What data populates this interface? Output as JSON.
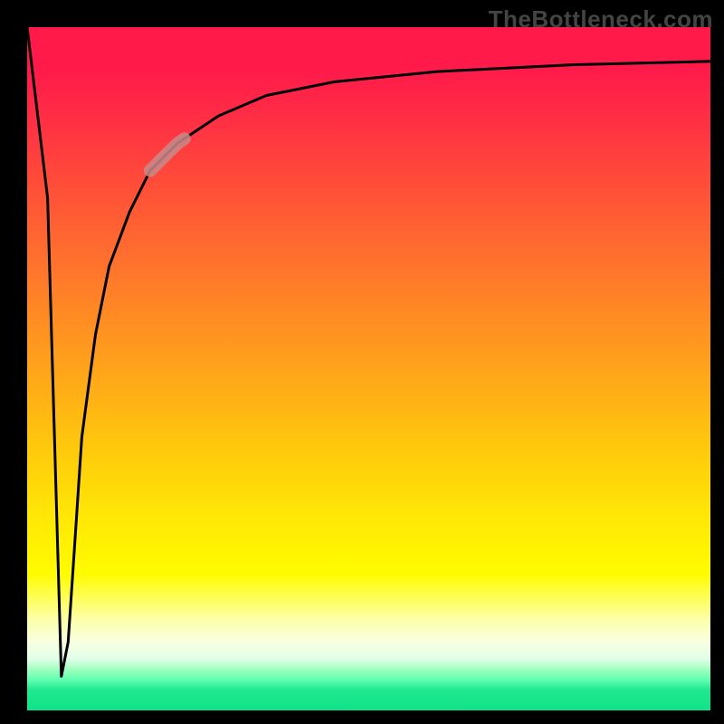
{
  "watermark": "TheBottleneck.com",
  "chart_data": {
    "type": "line",
    "title": "",
    "xlabel": "",
    "ylabel": "",
    "xlim": [
      0,
      100
    ],
    "ylim": [
      0,
      100
    ],
    "series": [
      {
        "name": "bottleneck-curve",
        "x": [
          0,
          3,
          4,
          5,
          6,
          7,
          8,
          10,
          12,
          15,
          18,
          22,
          28,
          35,
          45,
          60,
          80,
          100
        ],
        "values": [
          100,
          75,
          40,
          5,
          10,
          25,
          40,
          55,
          65,
          73,
          79,
          83,
          87,
          90,
          92,
          93.5,
          94.5,
          95
        ]
      }
    ],
    "annotations": [
      {
        "name": "highlight-segment",
        "x_range": [
          18,
          23
        ],
        "note": "muted highlight on curve"
      }
    ],
    "background": {
      "type": "vertical-gradient",
      "stops": [
        {
          "pct": 0,
          "color": "#ff1a4a"
        },
        {
          "pct": 50,
          "color": "#ff9a1c"
        },
        {
          "pct": 80,
          "color": "#fffc00"
        },
        {
          "pct": 100,
          "color": "#10e289"
        }
      ]
    }
  }
}
